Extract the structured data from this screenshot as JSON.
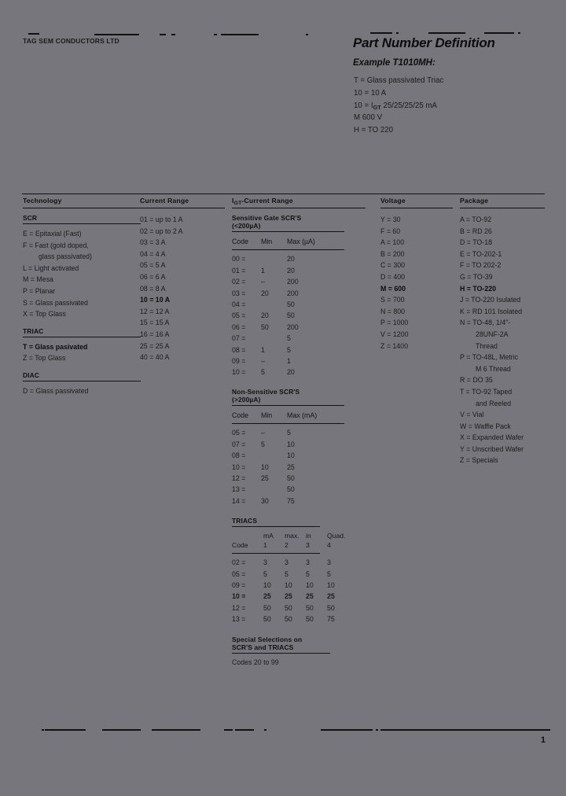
{
  "document": {
    "company": "TAG SEM CONDUCTORS LTD",
    "title": "Part Number Definition",
    "example_heading": "Example T1010MH:",
    "page_number": "1"
  },
  "example": {
    "lines": [
      {
        "code": "T =",
        "desc": "Glass passivated Triac"
      },
      {
        "code": "10 =",
        "desc": "10 A"
      },
      {
        "code": "10 =",
        "desc": "I",
        "sub": "GT",
        "desc2": " 25/25/25/25 mA"
      },
      {
        "code": "M",
        "desc": "600 V"
      },
      {
        "code": "H =",
        "desc": "TO 220"
      }
    ]
  },
  "columns": {
    "technology": {
      "header": "Technology",
      "groups": [
        {
          "title": "SCR",
          "items": [
            {
              "text": "E  = Epitaxial (Fast)"
            },
            {
              "text": "F  = Fast (gold doped,",
              "cont": "glass passivated)"
            },
            {
              "text": "L  = Light activated"
            },
            {
              "text": "M = Mesa"
            },
            {
              "text": "P  = Planar"
            },
            {
              "text": "S  = Glass passivated"
            },
            {
              "text": "X  = Top Glass"
            }
          ]
        },
        {
          "title": "TRIAC",
          "items": [
            {
              "text": "T  =  Glass pasivated",
              "bold": true
            },
            {
              "text": "Z  = Top Glass"
            }
          ]
        },
        {
          "title": "DIAC",
          "items": [
            {
              "text": "D  = Glass passivated"
            }
          ]
        }
      ]
    },
    "current_range": {
      "header": "Current Range",
      "items": [
        {
          "text": "01 = up to 1 A"
        },
        {
          "text": "02 = up to 2 A"
        },
        {
          "text": "03 = 3 A"
        },
        {
          "text": "04 = 4 A"
        },
        {
          "text": "05 = 5 A"
        },
        {
          "text": "06 = 6 A"
        },
        {
          "text": "08 = 8 A"
        },
        {
          "text": "10 = 10 A",
          "bold": true
        },
        {
          "text": "12 = 12 A"
        },
        {
          "text": "15 = 15 A"
        },
        {
          "text": "16 = 16 A"
        },
        {
          "text": "25 = 25 A"
        },
        {
          "text": "40 = 40 A"
        }
      ]
    },
    "igt_current_range": {
      "header_pre": "I",
      "header_sub": "GT",
      "header_post": "-Current Range",
      "sensitive": {
        "title_l1": "Sensitive Gate SCR'S",
        "title_l2": "(<200µA)",
        "head": {
          "code": "Code",
          "min": "Min",
          "max": "Max (µA)"
        },
        "rows": [
          {
            "code": "00 =",
            "min": "",
            "max": "20"
          },
          {
            "code": "01 =",
            "min": "1",
            "max": "20"
          },
          {
            "code": "02 =",
            "min": "–",
            "max": "200"
          },
          {
            "code": "03 =",
            "min": "20",
            "max": "200"
          },
          {
            "code": "04 =",
            "min": "",
            "max": "50"
          },
          {
            "code": "05 =",
            "min": "20",
            "max": "50"
          },
          {
            "code": "06 =",
            "min": "50",
            "max": "200"
          },
          {
            "code": "07 =",
            "min": "",
            "max": "5"
          },
          {
            "code": "08 =",
            "min": "1",
            "max": "5"
          },
          {
            "code": "09 =",
            "min": "–",
            "max": "1"
          },
          {
            "code": "10 =",
            "min": "5",
            "max": "20"
          }
        ]
      },
      "non_sensitive": {
        "title_l1": "Non-Sensitive SCR'S",
        "title_l2": "(>200µA)",
        "head": {
          "code": "Code",
          "min": "Min",
          "max": "Max (mA)"
        },
        "rows": [
          {
            "code": "05 =",
            "min": "–",
            "max": "5"
          },
          {
            "code": "07 =",
            "min": "5",
            "max": "10"
          },
          {
            "code": "08 =",
            "min": "",
            "max": "10"
          },
          {
            "code": "10 =",
            "min": "10",
            "max": "25"
          },
          {
            "code": "12 =",
            "min": "25",
            "max": "50"
          },
          {
            "code": "13 =",
            "min": "",
            "max": "50"
          },
          {
            "code": "14 =",
            "min": "30",
            "max": "75"
          }
        ]
      },
      "triacs": {
        "title": "TRIACS",
        "head_top": [
          "mA",
          "max.",
          "in",
          "Quad."
        ],
        "head_bottom": [
          "Code",
          "1",
          "2",
          "3",
          "4"
        ],
        "rows": [
          {
            "code": "02 =",
            "q": [
              "3",
              "3",
              "3",
              "3"
            ]
          },
          {
            "code": "05 =",
            "q": [
              "5",
              "5",
              "5",
              "5"
            ]
          },
          {
            "code": "09 =",
            "q": [
              "10",
              "10",
              "10",
              "10"
            ]
          },
          {
            "code": "10 =",
            "q": [
              "25",
              "25",
              "25",
              "25"
            ],
            "bold": true
          },
          {
            "code": "12 =",
            "q": [
              "50",
              "50",
              "50",
              "50"
            ]
          },
          {
            "code": "13 =",
            "q": [
              "50",
              "50",
              "50",
              "75"
            ]
          }
        ]
      },
      "special": {
        "title_l1": "Special Selections on",
        "title_l2": "SCR'S and TRIACS",
        "note": "Codes 20 to 99"
      }
    },
    "voltage": {
      "header": "Voltage",
      "items": [
        {
          "text": "Y =    30"
        },
        {
          "text": "F =    60"
        },
        {
          "text": "A =   100"
        },
        {
          "text": "B =   200"
        },
        {
          "text": "C =   300"
        },
        {
          "text": "D =   400"
        },
        {
          "text": "M =   600",
          "bold": true
        },
        {
          "text": "S =   700"
        },
        {
          "text": "N =   800"
        },
        {
          "text": "P =  1000"
        },
        {
          "text": "V =  1200"
        },
        {
          "text": "Z =  1400"
        }
      ]
    },
    "package": {
      "header": "Package",
      "items": [
        {
          "text": "A = TO-92"
        },
        {
          "text": "B = RD 26"
        },
        {
          "text": "D = TO-18"
        },
        {
          "text": "E = TO-202-1"
        },
        {
          "text": "F = TO 202-2"
        },
        {
          "text": "G = TO-39"
        },
        {
          "text": "H = TO-220",
          "bold": true
        },
        {
          "text": "J =  TO-220 Isulated"
        },
        {
          "text": "K = RD 101 Isolated"
        },
        {
          "text": "N = TO-48, 1/4\"-",
          "cont": "28UNF-2A",
          "cont2": "Thread"
        },
        {
          "text": "P = TO-48L, Metric",
          "cont": "M 6 Thread"
        },
        {
          "text": "R = DO 35"
        },
        {
          "text": "T = TO-92 Taped",
          "cont": "and Reeled"
        },
        {
          "text": "V = Vial"
        },
        {
          "text": "W = Waffle Pack"
        },
        {
          "text": "X = Expanded Wafer"
        },
        {
          "text": "Y = Unscribed Wafer"
        },
        {
          "text": "Z = Specials"
        }
      ]
    }
  }
}
